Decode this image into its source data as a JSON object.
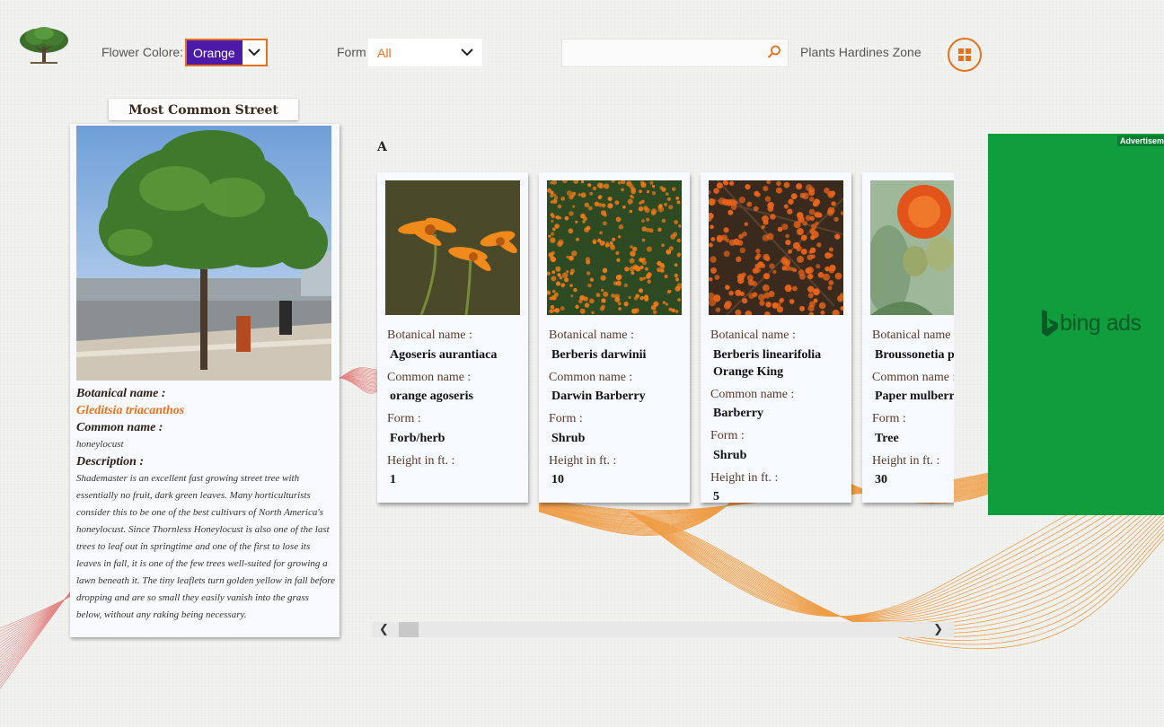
{
  "header": {
    "flower_color_label": "Flower Colore:",
    "flower_color_value": "Orange",
    "form_label": "Form",
    "form_value": "All",
    "search_value": "",
    "zone_label": "Plants Hardines Zone"
  },
  "colors": {
    "accent": "#e8701d",
    "selected_bg": "#4a1aa8",
    "ad_bg": "#0f9d3e"
  },
  "featured": {
    "panel_title": "Most Common Street Trees",
    "botanical_label": "Botanical name :",
    "botanical_name": "Gleditsia triacanthos",
    "common_label": "Common name :",
    "common_name": "honeylocust",
    "description_label": "Description :",
    "description": "Shademaster is an excellent fast growing street tree with essentially no fruit, dark green leaves. Many horticulturists consider this to be one of the best cultivars of North America's honeylocust. Since Thornless Honeylocust is also one of the last trees to leaf out in springtime and one of the first to lose its leaves in fall, it is one of the few trees well-suited for growing a lawn beneath it. The tiny leaflets turn golden yellow in fall before dropping and are so small they easily vanish into the grass below, without any raking being necessary."
  },
  "section": {
    "letter": "A",
    "labels": {
      "botanical": "Botanical name :",
      "common": "Common name :",
      "form": "Form :",
      "height": "Height in ft. :"
    },
    "plants": [
      {
        "botanical": "Agoseris aurantiaca",
        "common": "orange agoseris",
        "form": "Forb/herb",
        "height": "1",
        "icon": "orange-daisy-photo"
      },
      {
        "botanical": "Berberis darwinii",
        "common": "Darwin Barberry",
        "form": "Shrub",
        "height": "10",
        "icon": "orange-shrub-photo"
      },
      {
        "botanical": "Berberis linearifolia Orange King",
        "common": "Barberry",
        "form": "Shrub",
        "height": "5",
        "icon": "orange-berry-photo"
      },
      {
        "botanical": "Broussonetia papyrifera",
        "common": "Paper mulberry",
        "form": "Tree",
        "height": "30",
        "icon": "orange-flower-photo"
      }
    ]
  },
  "ad": {
    "label": "Advertisement",
    "brand": "bing ads"
  }
}
